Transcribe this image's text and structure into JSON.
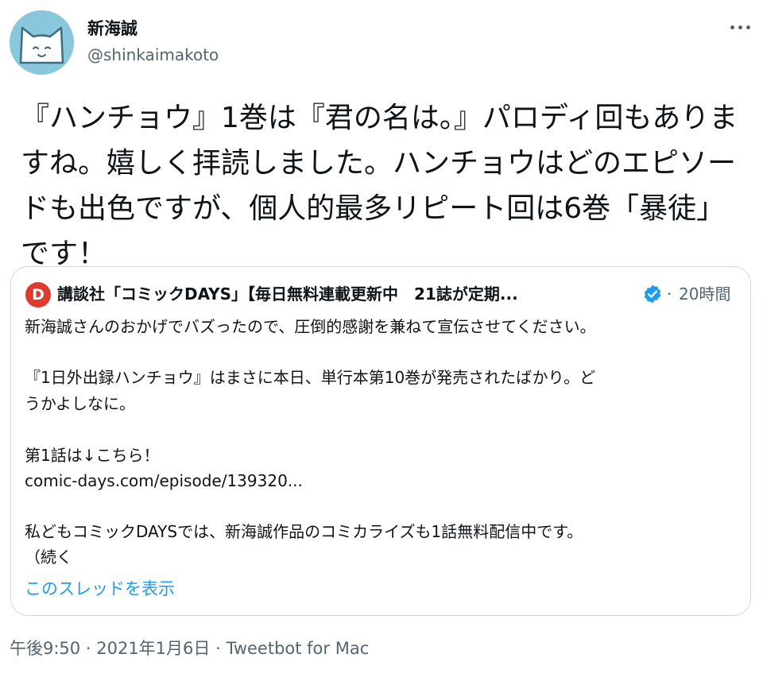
{
  "author": {
    "display_name": "新海誠",
    "handle": "@shinkaimakoto",
    "avatar_icon": "cat-face-avatar-icon",
    "avatar_color": "#89c7dd"
  },
  "tweet": {
    "text": "『ハンチョウ』1巻は『君の名は。』パロディ回もありますね。嬉しく拝読しました。ハンチョウはどのエピソードも出色ですが、個人的最多リピート回は6巻「暴徒」です！"
  },
  "quote": {
    "logo_letter": "D",
    "logo_color": "#e03a2e",
    "account_name": "講談社「コミックDAYS」【毎日無料連載更新中　21誌が定期...",
    "verified_icon": "verified-badge-icon",
    "verified_color": "#1d9bf0",
    "separator": "·",
    "time": "20時間",
    "lines": [
      "新海誠さんのおかげでバズったので、圧倒的感謝を兼ねて宣伝させてください。",
      "『1日外出録ハンチョウ』はまさに本日、単行本第10巻が発売されたばかり。ど",
      "うかよしなに。",
      "第1話は↓こちら！",
      "comic-days.com/episode/139320...",
      "私どもコミックDAYSでは、新海誠作品のコミカライズも1話無料配信中です。",
      "（続く"
    ],
    "show_thread": "このスレッドを表示"
  },
  "meta": {
    "time": "午後9:50",
    "sep1": "·",
    "date": "2021年1月6日",
    "sep2": "·",
    "source": "Tweetbot for Mac"
  },
  "colors": {
    "text": "#0f1419",
    "secondary": "#536471",
    "link": "#1d9bf0",
    "border": "#cfd9de"
  }
}
